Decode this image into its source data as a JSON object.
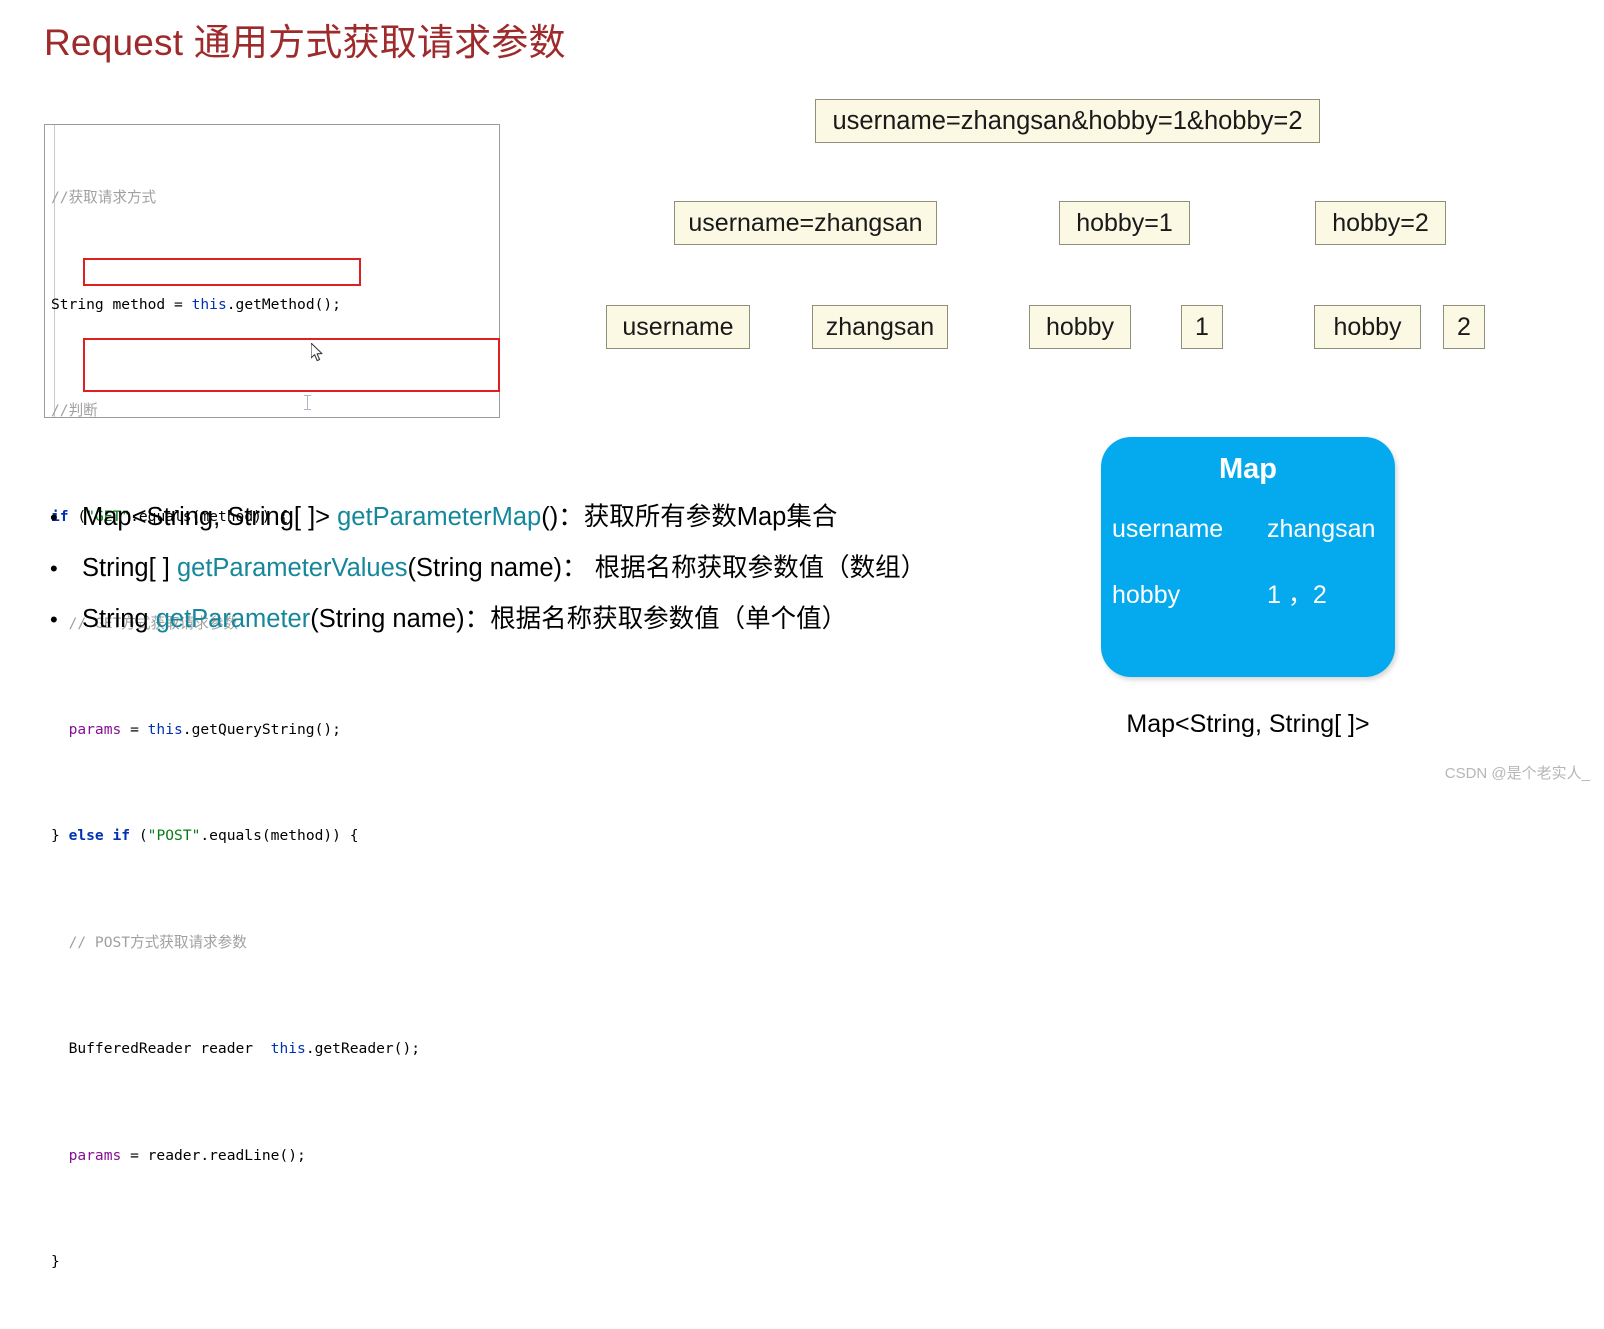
{
  "slide": {
    "title": "Request 通用方式获取请求参数",
    "title_color": "#9e2a2b"
  },
  "code_block": {
    "language": "java",
    "lines": [
      {
        "id": "l1",
        "text": "//获取请求方式"
      },
      {
        "id": "l2",
        "text": "String method = this.getMethod();"
      },
      {
        "id": "l3",
        "text": "//判断"
      },
      {
        "id": "l4",
        "text": "if (\"GET\".equals(method)) {"
      },
      {
        "id": "l5",
        "text": "    // GET方式获取请求参数"
      },
      {
        "id": "l6",
        "text": "    params = this.getQueryString();"
      },
      {
        "id": "l7",
        "text": "} else if (\"POST\".equals(method)) {"
      },
      {
        "id": "l8",
        "text": "    // POST方式获取请求参数"
      },
      {
        "id": "l9",
        "text": "    BufferedReader reader  this.getReader();"
      },
      {
        "id": "l10",
        "text": "    params = reader.readLine();"
      },
      {
        "id": "l11",
        "text": "}"
      }
    ],
    "tokens": {
      "comment_1": "//获取请求方式",
      "comment_2": "//判断",
      "comment_3": "// GET方式获取请求参数",
      "comment_4": "// POST方式获取请求参数",
      "type_string": "String",
      "var_method": " method = ",
      "this_1": "this",
      "call_getmethod": ".getMethod();",
      "kw_if": "if",
      "if_open": " (",
      "str_get": "\"GET\"",
      "equals_method": ".equals(method)) {",
      "fld_params_1": "params",
      "assign_1": " = ",
      "this_2": "this",
      "call_getquerystring": ".getQueryString();",
      "brace_else": "} ",
      "kw_else": "else",
      "kw_if2": " if",
      "if_open2": " (",
      "str_post": "\"POST\"",
      "equals_method2": ".equals(method)) {",
      "type_bufferedreader": "BufferedReader reader  ",
      "this_3": "this",
      "call_getreader": ".getReader();",
      "fld_params_2": "params",
      "assign_2": " = reader.readLine();",
      "brace_close": "}"
    },
    "highlight_color": "#e02020",
    "highlights": [
      {
        "id": "hl-get",
        "target_line": "l6"
      },
      {
        "id": "hl-post",
        "target_line": "l9"
      }
    ]
  },
  "api_list": [
    {
      "bullet": "•",
      "prefix": "Map<String, String[ ]> ",
      "method": "getParameterMap",
      "suffix": "()：获取所有参数Map集合"
    },
    {
      "bullet": "•",
      "prefix": "String[ ] ",
      "method": "getParameterValues",
      "suffix": "(String name)： 根据名称获取参数值（数组）"
    },
    {
      "bullet": "•",
      "prefix": "String ",
      "method": "getParameter",
      "suffix": "(String name)：根据名称获取参数值（单个值）"
    }
  ],
  "api_name_color": "#15879b",
  "param_flow": {
    "query_string": "username=zhangsan&hobby=1&hobby=2",
    "level2": [
      "username=zhangsan",
      "hobby=1",
      "hobby=2"
    ],
    "level3": [
      "username",
      "zhangsan",
      "hobby",
      "1",
      "hobby",
      "2"
    ],
    "box_background": "#fbf8e3",
    "box_border": "#8f8f7a"
  },
  "map_card": {
    "title": "Map",
    "background": "#04a9ee",
    "entries": [
      {
        "key": "username",
        "value": "zhangsan"
      },
      {
        "key": "hobby",
        "value": "1 ，2"
      }
    ],
    "caption": "Map<String, String[ ]>"
  },
  "watermark": "CSDN @是个老实人_"
}
